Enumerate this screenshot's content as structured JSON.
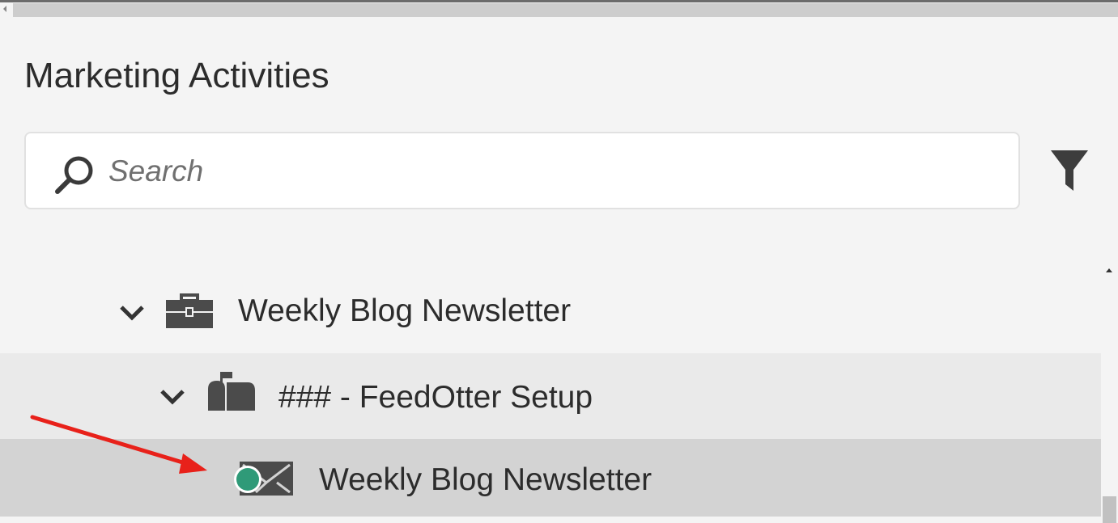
{
  "panel": {
    "title": "Marketing Activities"
  },
  "search": {
    "placeholder": "Search",
    "value": ""
  },
  "tree": {
    "program": {
      "label": "Weekly Blog Newsletter",
      "icon": "briefcase-icon",
      "expanded": true
    },
    "folder": {
      "label": "### - FeedOtter Setup",
      "icon": "mailbox-icon",
      "expanded": true
    },
    "email": {
      "label": "Weekly Blog Newsletter",
      "icon": "email-icon",
      "status_color": "#2f9a78",
      "selected": true
    }
  },
  "colors": {
    "annotation_arrow": "#e8211a",
    "selected_row": "#d3d3d3",
    "folder_row": "#eaeaea",
    "icon_gray": "#4b4b4b"
  }
}
